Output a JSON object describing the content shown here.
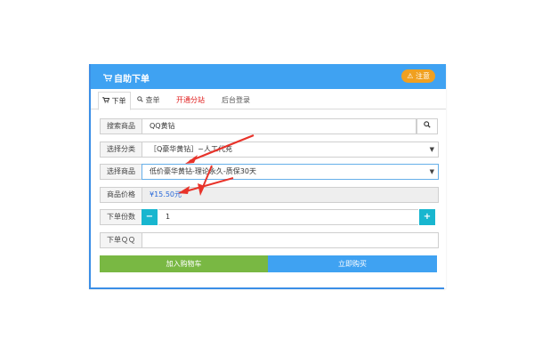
{
  "header": {
    "title": "自助下单",
    "notice_label": "注意",
    "cart_icon": "cart-icon",
    "warning_icon": "warning-icon"
  },
  "tabs": [
    {
      "label": "下单",
      "icon": "cart-icon",
      "active": true
    },
    {
      "label": "查单",
      "icon": "search-icon",
      "active": false
    },
    {
      "label": "开通分站",
      "active": false,
      "color": "#e02020"
    },
    {
      "label": "后台登录",
      "active": false
    }
  ],
  "form": {
    "search": {
      "label": "搜索商品",
      "value": "QQ黄钻"
    },
    "category": {
      "label": "选择分类",
      "value": "［Q豪华黄钻］~人工代充"
    },
    "product": {
      "label": "选择商品",
      "value": "低价豪华黄钻-理论永久-质保30天"
    },
    "price": {
      "label": "商品价格",
      "value": "¥15.50元"
    },
    "quantity": {
      "label": "下单份数",
      "value": "1",
      "minus": "−",
      "plus": "+"
    },
    "qq": {
      "label": "下单ＱＱ",
      "value": ""
    }
  },
  "buttons": {
    "add_cart": "加入购物车",
    "buy_now": "立即购买"
  },
  "colors": {
    "header": "#3fa2f2",
    "notice": "#f0a020",
    "add_cart": "#79b843",
    "buy_now": "#3fa2f2",
    "stepper": "#18b6cf",
    "arrow": "#e8332a"
  }
}
